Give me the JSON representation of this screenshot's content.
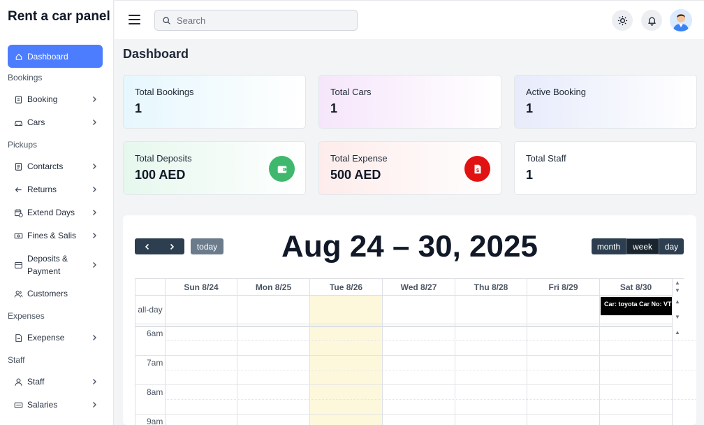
{
  "brand": "Rent a car panel",
  "sidebar": {
    "active": "Dashboard",
    "sections": {
      "bookings": "Bookings",
      "pickups": "Pickups",
      "expenses": "Expenses",
      "staff": "Staff"
    },
    "items": {
      "booking": "Booking",
      "cars": "Cars",
      "contracts": "Contarcts",
      "returns": "Returns",
      "extend": "Extend Days",
      "fines": "Fines & Salis",
      "deposits": "Deposits &",
      "deposits2": "Payment",
      "customers": "Customers",
      "expense": "Exepense",
      "staff": "Staff",
      "salaries": "Salaries"
    }
  },
  "topbar": {
    "search_placeholder": "Search"
  },
  "page": {
    "title": "Dashboard"
  },
  "cards": {
    "total_bookings": {
      "title": "Total Bookings",
      "value": "1"
    },
    "total_cars": {
      "title": "Total Cars",
      "value": "1"
    },
    "active_booking": {
      "title": "Active Booking",
      "value": "1"
    },
    "total_deposits": {
      "title": "Total Deposits",
      "value": "100 AED"
    },
    "total_expense": {
      "title": "Total Expense",
      "value": "500 AED"
    },
    "total_staff": {
      "title": "Total Staff",
      "value": "1"
    }
  },
  "colors": {
    "primary": "#4d7dff",
    "deposit_badge": "#3fb86d",
    "expense_badge": "#e11212",
    "today_col": "#fdf8dc",
    "toolbar_btn": "#2c3e50"
  },
  "calendar": {
    "title": "Aug 24 – 30, 2025",
    "today_label": "today",
    "views": {
      "month": "month",
      "week": "week",
      "day": "day"
    },
    "active_view": "week",
    "days": [
      "Sun 8/24",
      "Mon 8/25",
      "Tue 8/26",
      "Wed 8/27",
      "Thu 8/28",
      "Fri 8/29",
      "Sat 8/30"
    ],
    "allday_label": "all-day",
    "hours": [
      "6am",
      "7am",
      "8am",
      "9am"
    ],
    "event": {
      "label": "Car: toyota Car No: VT",
      "day": "Sat 8/30"
    }
  }
}
